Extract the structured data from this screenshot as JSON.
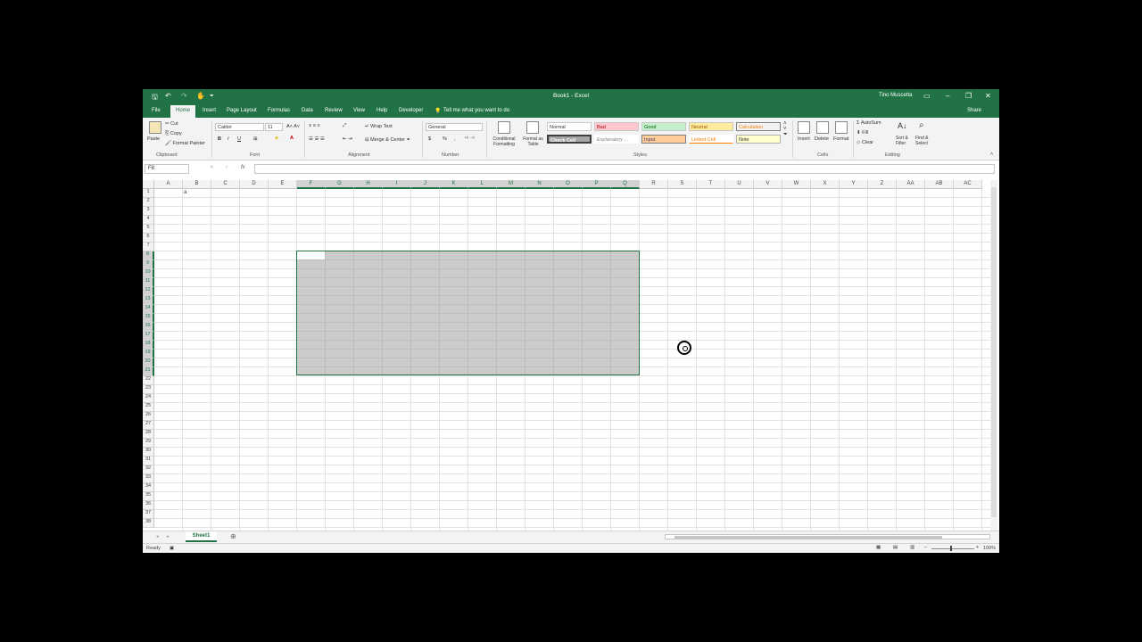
{
  "title": "Book1 - Excel",
  "user": "Tino Muscetta",
  "window_buttons": {
    "ribbon_display": "▭",
    "minimize": "–",
    "restore": "❐",
    "close": "✕"
  },
  "quick_access": {
    "save": "🖫",
    "undo": "↶",
    "redo": "↷",
    "touch": "✋",
    "customize": "⏷"
  },
  "tabs": [
    "File",
    "Home",
    "Insert",
    "Page Layout",
    "Formulas",
    "Data",
    "Review",
    "View",
    "Help",
    "Developer"
  ],
  "tell_me": "Tell me what you want to do",
  "share": "Share",
  "ribbon": {
    "clipboard": {
      "paste": "Paste",
      "cut": "Cut",
      "copy": "Copy",
      "format_painter": "Format Painter",
      "label": "Clipboard"
    },
    "font": {
      "name": "Calibri",
      "size": "11",
      "bold": "B",
      "italic": "I",
      "underline": "U",
      "label": "Font"
    },
    "alignment": {
      "wrap": "Wrap Text",
      "merge": "Merge & Center",
      "label": "Alignment"
    },
    "number": {
      "format": "General",
      "dollar": "$",
      "percent": "%",
      "comma": ",",
      "label": "Number"
    },
    "styles": {
      "conditional": "Conditional Formatting",
      "format_as_table": "Format as Table",
      "cells": [
        "Normal",
        "Bad",
        "Good",
        "Neutral",
        "Calculation",
        "Check Cell",
        "Explanatory ...",
        "Input",
        "Linked Cell",
        "Note"
      ],
      "label": "Styles"
    },
    "cells": {
      "insert": "Insert",
      "delete": "Delete",
      "format": "Format",
      "label": "Cells"
    },
    "editing": {
      "autosum": "AutoSum",
      "fill": "Fill",
      "clear": "Clear",
      "sort": "Sort & Filter",
      "find": "Find & Select",
      "label": "Editing"
    }
  },
  "name_box": "F8",
  "fx": "fx",
  "columns": [
    "A",
    "B",
    "C",
    "D",
    "E",
    "F",
    "G",
    "H",
    "I",
    "J",
    "K",
    "L",
    "M",
    "N",
    "O",
    "P",
    "Q",
    "R",
    "S",
    "T",
    "U",
    "V",
    "W",
    "X",
    "Y",
    "Z",
    "AA",
    "AB",
    "AC"
  ],
  "rows": [
    "1",
    "2",
    "3",
    "4",
    "5",
    "6",
    "7",
    "8",
    "9",
    "10",
    "11",
    "12",
    "13",
    "14",
    "15",
    "16",
    "17",
    "18",
    "19",
    "20",
    "21",
    "22",
    "23",
    "24",
    "25",
    "26",
    "27",
    "28",
    "29",
    "30",
    "31",
    "32",
    "33",
    "34",
    "35",
    "36",
    "37",
    "38"
  ],
  "selected_columns": [
    "F",
    "G",
    "H",
    "I",
    "J",
    "K",
    "L",
    "M",
    "N",
    "O",
    "P",
    "Q"
  ],
  "selected_rows": [
    "8",
    "9",
    "10",
    "11",
    "12",
    "13",
    "14",
    "15",
    "16",
    "17",
    "18",
    "19",
    "20",
    "21"
  ],
  "cell_b1": "a",
  "sheet_tab": "Sheet1",
  "add_sheet": "⊕",
  "status": "Ready",
  "zoom": "100%",
  "colors": {
    "accent": "#217346",
    "selection": "#a0a0a0"
  }
}
